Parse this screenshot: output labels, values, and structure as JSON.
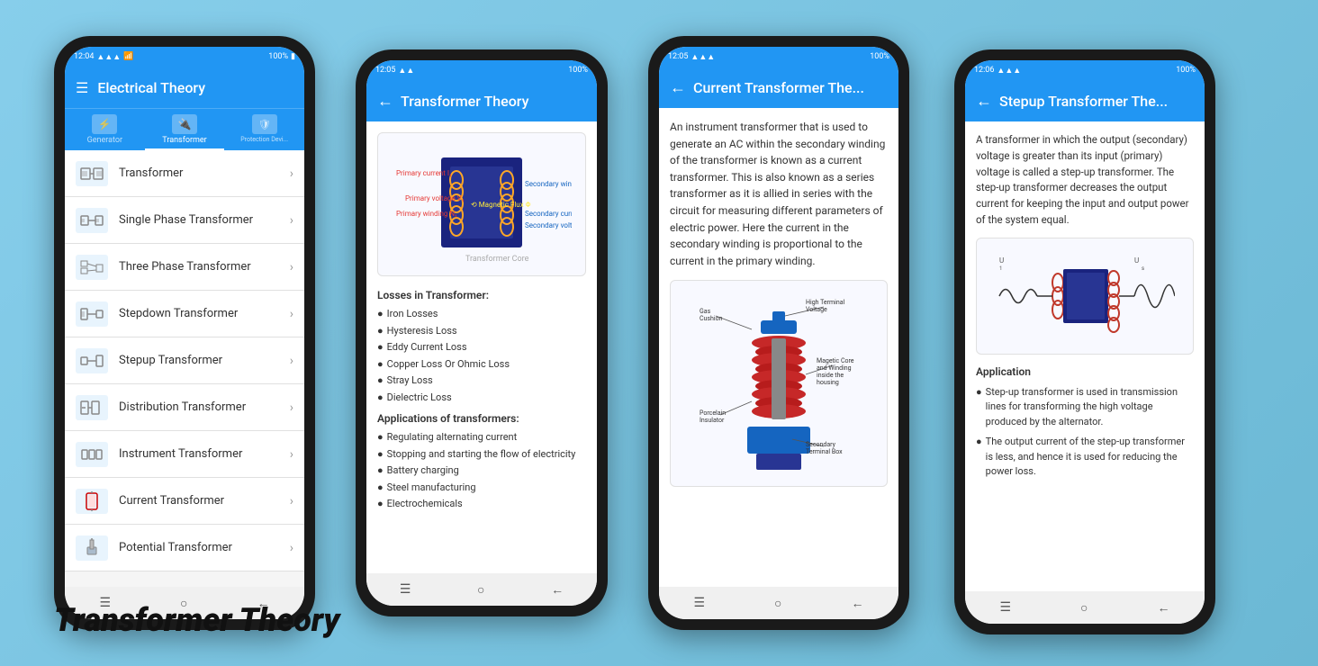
{
  "page": {
    "background": "#7ec8e3",
    "title": "Transformer Theory"
  },
  "phone1": {
    "status": {
      "time": "12:04",
      "battery": "100%"
    },
    "header": {
      "title": "Electrical Theory"
    },
    "tabs": [
      {
        "label": "Generator",
        "active": false
      },
      {
        "label": "Transformer",
        "active": true
      },
      {
        "label": "Protection Devi...",
        "active": false
      }
    ],
    "menu_items": [
      {
        "label": "Transformer"
      },
      {
        "label": "Single Phase Transformer"
      },
      {
        "label": "Three Phase Transformer"
      },
      {
        "label": "Stepdown Transformer"
      },
      {
        "label": "Stepup Transformer"
      },
      {
        "label": "Distribution Transformer"
      },
      {
        "label": "Instrument Transformer"
      },
      {
        "label": "Current Transformer"
      },
      {
        "label": "Potential Transformer"
      }
    ]
  },
  "phone2": {
    "status": {
      "time": "12:05",
      "battery": "100%"
    },
    "header": {
      "title": "Transformer Theory"
    },
    "content": {
      "losses_title": "Losses in Transformer:",
      "losses": [
        "Iron Losses",
        "Hysteresis Loss",
        "Eddy Current Loss",
        "Copper Loss Or Ohmic Loss",
        "Stray Loss",
        "Dielectric Loss"
      ],
      "applications_title": "Applications of transformers:",
      "applications": [
        "Regulating alternating current",
        "Stopping and starting the flow of electricity",
        "Battery charging",
        "Steel manufacturing",
        "Electrochemicals"
      ]
    }
  },
  "phone3": {
    "status": {
      "time": "12:05",
      "battery": "100%"
    },
    "header": {
      "title": "Current Transformer The..."
    },
    "content": {
      "text": "An instrument transformer that is used to generate an AC within the secondary winding of the transformer is known as a current transformer. This is also known as a series transformer as it is allied in series with the circuit for measuring different parameters of electric power. Here the current in the secondary winding is proportional to the current in the primary winding.",
      "diagram_labels": {
        "gas_cushion": "Gas Cushion",
        "high_terminal": "High Terminal Voltage",
        "magetic_core": "Magetic Core and Winding inside the housing",
        "porcelain": "Porcelain Insulator",
        "secondary": "Secondary Terminal Box"
      }
    }
  },
  "phone4": {
    "status": {
      "time": "12:06",
      "battery": "100%"
    },
    "header": {
      "title": "Stepup Transformer The..."
    },
    "content": {
      "main_text": "A transformer in which the output (secondary) voltage is greater than its input (primary) voltage is called a step-up transformer. The step-up transformer decreases the output current for keeping the input and output power of the system equal.",
      "application_title": "Application",
      "applications": [
        "Step-up transformer is used in transmission lines for transforming the high voltage produced by the alternator.",
        "The output current of the step-up transformer is less, and hence it is used for reducing the power loss."
      ]
    }
  }
}
